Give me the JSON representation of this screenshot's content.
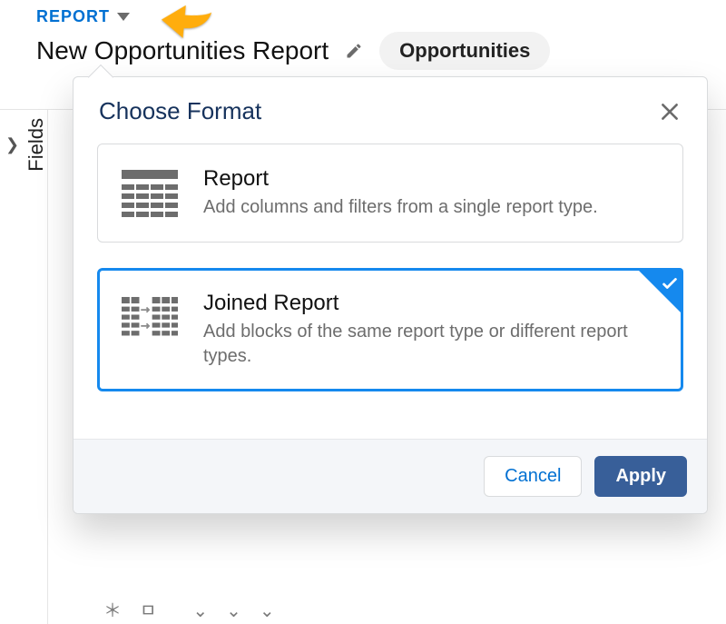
{
  "header": {
    "type_label": "REPORT",
    "title": "New Opportunities Report",
    "pill": "Opportunities"
  },
  "sidebar": {
    "label": "Fields"
  },
  "modal": {
    "title": "Choose Format",
    "options": [
      {
        "title": "Report",
        "desc": "Add columns and filters from a single report type.",
        "selected": false
      },
      {
        "title": "Joined Report",
        "desc": "Add blocks of the same report type or different report types.",
        "selected": true
      }
    ],
    "cancel_label": "Cancel",
    "apply_label": "Apply"
  }
}
